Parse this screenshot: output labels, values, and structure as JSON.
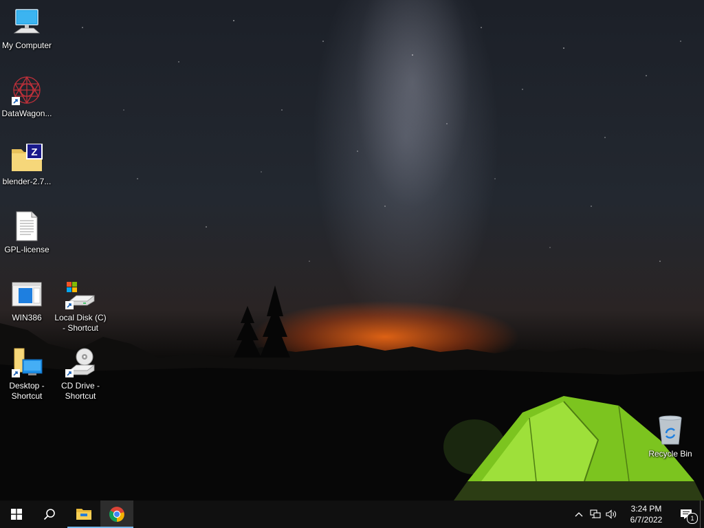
{
  "desktop": {
    "icons": [
      {
        "label": "My Computer",
        "icon": "computer-icon"
      },
      {
        "label": "DataWagon...",
        "icon": "datawagon-icon"
      },
      {
        "label": "blender-2.7...",
        "icon": "zip-folder-icon"
      },
      {
        "label": "GPL-license",
        "icon": "text-document-icon"
      },
      {
        "label": "WIN386",
        "icon": "application-window-icon"
      },
      {
        "label": "Local Disk (C) - Shortcut",
        "icon": "hard-drive-icon"
      },
      {
        "label": "Desktop - Shortcut",
        "icon": "desktop-folder-icon"
      },
      {
        "label": "CD Drive - Shortcut",
        "icon": "cd-drive-icon"
      },
      {
        "label": "Recycle Bin",
        "icon": "recycle-bin-icon"
      }
    ]
  },
  "taskbar": {
    "start": "windows-start-icon",
    "search": "search-icon",
    "pinned": [
      "file-explorer-icon",
      "chrome-icon"
    ],
    "tray_icons": [
      "chevron-up-icon",
      "network-icon",
      "volume-icon"
    ],
    "clock": {
      "time": "3:24 PM",
      "date": "6/7/2022"
    },
    "notifications": {
      "icon": "action-center-icon",
      "count": "1"
    }
  },
  "colors": {
    "taskbar": "#101010",
    "active_underline": "#76b9ed",
    "tent": "#8fd62a"
  }
}
